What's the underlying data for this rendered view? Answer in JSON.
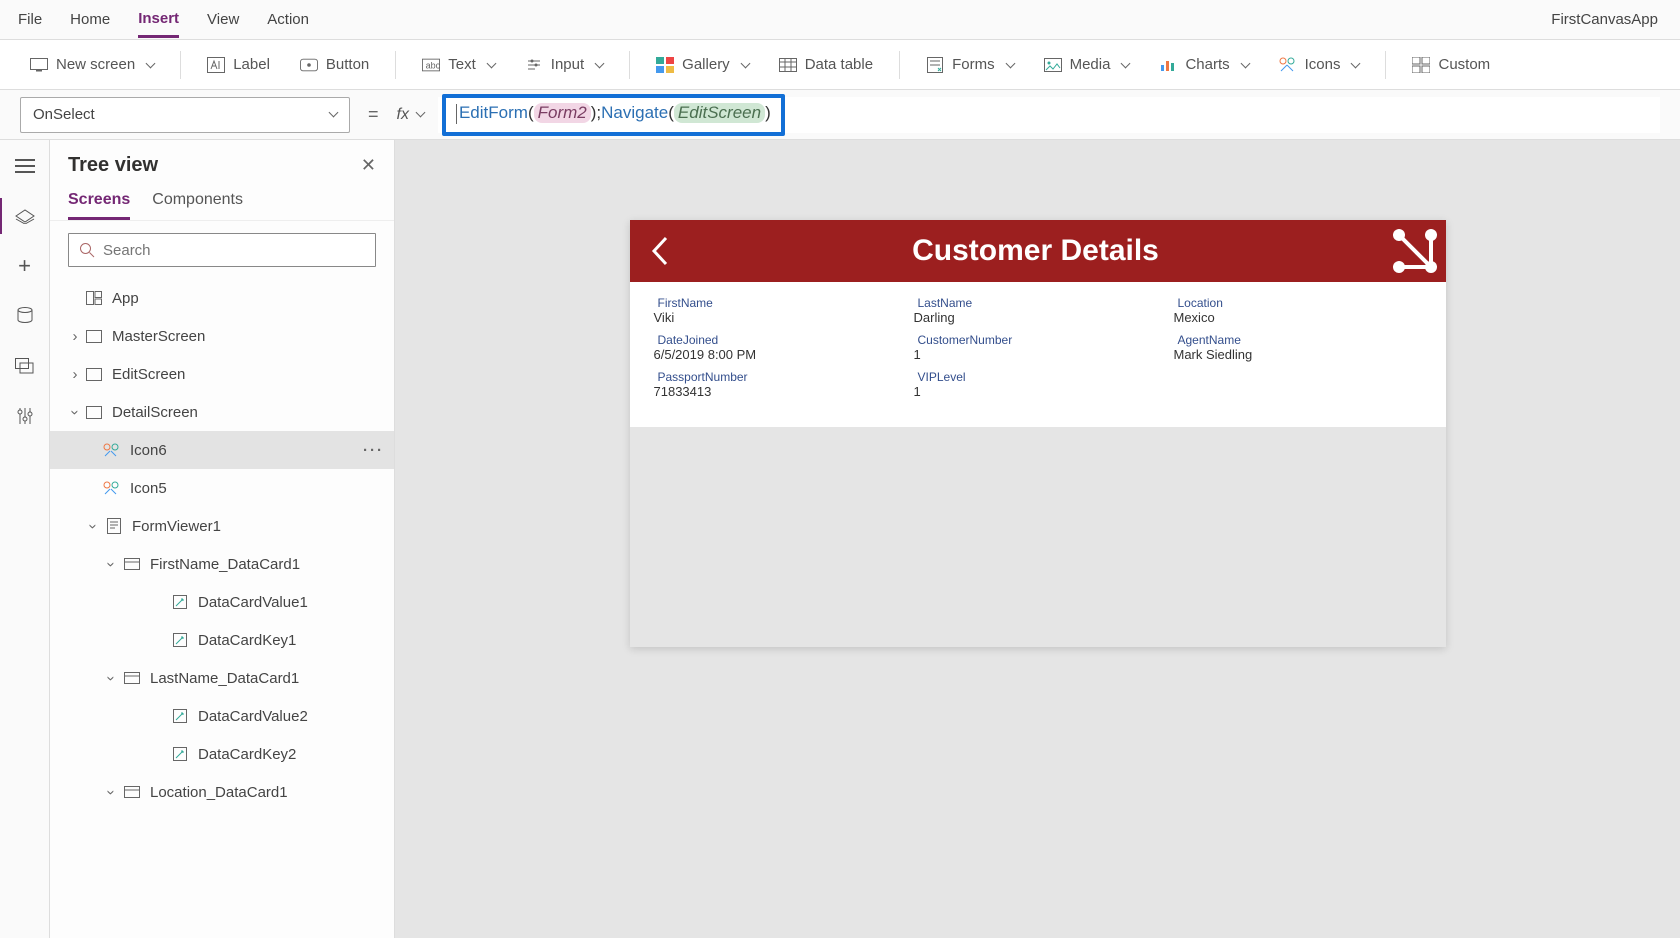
{
  "appTitle": "FirstCanvasApp",
  "menu": {
    "file": "File",
    "home": "Home",
    "insert": "Insert",
    "view": "View",
    "action": "Action"
  },
  "ribbon": {
    "newScreen": "New screen",
    "label": "Label",
    "button": "Button",
    "text": "Text",
    "input": "Input",
    "gallery": "Gallery",
    "dataTable": "Data table",
    "forms": "Forms",
    "media": "Media",
    "charts": "Charts",
    "icons": "Icons",
    "custom": "Custom"
  },
  "formula": {
    "property": "OnSelect",
    "fx": "fx",
    "eq": "=",
    "fn1": "EditForm",
    "arg1": "Form2",
    "fn2": "Navigate",
    "arg2": "EditScreen",
    "lp": "(",
    "rp": ")",
    "semi": ";"
  },
  "tree": {
    "title": "Tree view",
    "tabScreens": "Screens",
    "tabComponents": "Components",
    "searchPlaceholder": "Search",
    "app": "App",
    "masterScreen": "MasterScreen",
    "editScreen": "EditScreen",
    "detailScreen": "DetailScreen",
    "icon6": "Icon6",
    "icon5": "Icon5",
    "formViewer1": "FormViewer1",
    "fnCard": "FirstName_DataCard1",
    "dcVal1": "DataCardValue1",
    "dcKey1": "DataCardKey1",
    "lnCard": "LastName_DataCard1",
    "dcVal2": "DataCardValue2",
    "dcKey2": "DataCardKey2",
    "locCard": "Location_DataCard1"
  },
  "canvas": {
    "headerTitle": "Customer Details",
    "fields": {
      "firstName": {
        "label": "FirstName",
        "value": "Viki"
      },
      "lastName": {
        "label": "LastName",
        "value": "Darling"
      },
      "location": {
        "label": "Location",
        "value": "Mexico"
      },
      "dateJoined": {
        "label": "DateJoined",
        "value": "6/5/2019 8:00 PM"
      },
      "custNum": {
        "label": "CustomerNumber",
        "value": "1"
      },
      "agent": {
        "label": "AgentName",
        "value": "Mark Siedling"
      },
      "passport": {
        "label": "PassportNumber",
        "value": "71833413"
      },
      "vip": {
        "label": "VIPLevel",
        "value": "1"
      }
    }
  }
}
